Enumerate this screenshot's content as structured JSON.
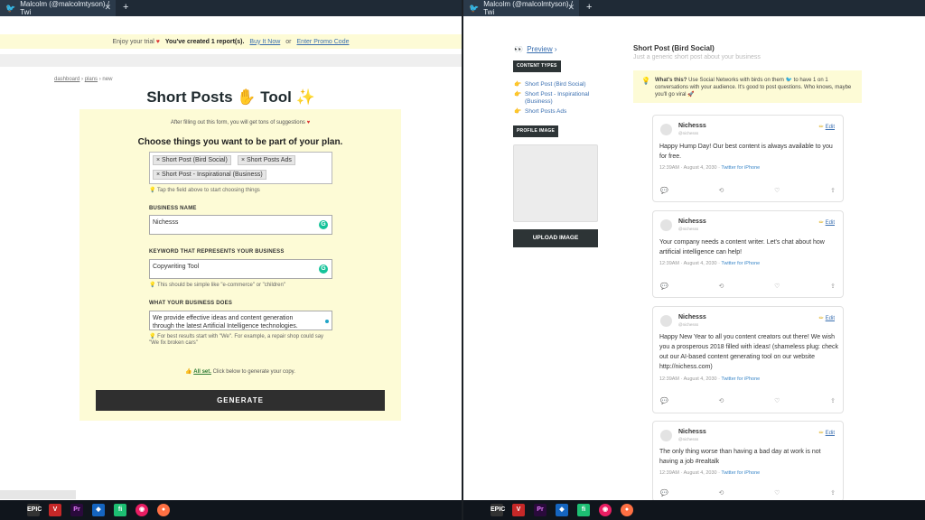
{
  "left": {
    "tab_title": "Malcolm (@malcolmtyson) / Twi",
    "trial": {
      "text": "Enjoy your trial",
      "created": "You've created 1 report(s).",
      "buy": "Buy It Now",
      "or": "or",
      "promo": "Enter Promo Code"
    },
    "breadcrumb": {
      "dashboard": "dashboard",
      "plans": "plans",
      "current": "new",
      "sep": "›"
    },
    "title": "Short Posts",
    "title_tool": "Tool",
    "intro": "After filling out this form, you will get tons of suggestions",
    "heading": "Choose things you want to be part of your plan.",
    "tags": [
      "Short Post (Bird Social)",
      "Short Posts Ads",
      "Short Post - Inspirational (Business)"
    ],
    "tag_hint": "Tap the field above to start choosing things",
    "business_name_label": "BUSINESS NAME",
    "business_name_value": "Nichesss",
    "keyword_label": "KEYWORD THAT REPRESENTS YOUR BUSINESS",
    "keyword_value": "Copywriting Tool",
    "keyword_hint": "This should be simple like \"e-commerce\" or \"children\"",
    "does_label": "WHAT YOUR BUSINESS DOES",
    "does_value_1": "We provide effective ideas and content generation",
    "does_value_2": "through the latest Artificial Intelligence technologies.",
    "does_hint_1": "For best results start with \"We\". For example, a repair shop could say",
    "does_hint_2": "\"We fix broken cars\"",
    "allset_link": "All set.",
    "allset_text": "Click below to generate your copy.",
    "generate_label": "GENERATE"
  },
  "right": {
    "tab_title": "Malcolm (@malcolmtyson) / Twi",
    "preview_label": "Preview",
    "content_types_label": "CONTENT TYPES",
    "content_types": [
      {
        "label": "Short Post (Bird Social)"
      },
      {
        "label": "Short Post - Inspirational (Business)"
      },
      {
        "label": "Short Posts Ads"
      }
    ],
    "profile_image_label": "PROFILE IMAGE",
    "upload_label": "UPLOAD IMAGE",
    "title": "Short Post (Bird Social)",
    "subtitle": "Just a generic short post about your business",
    "tip_bold": "What's this?",
    "tip_text": "Use Social Networks with birds on them",
    "tip_text_2": "to have 1 on 1 conversations with your audience. It's good to post questions. Who knows, maybe you'll go viral",
    "tweets": [
      {
        "name": "Nichesss",
        "handle": "@nichesss",
        "edit": "Edit",
        "text": "Happy Hump Day!  Our best content is always available to you for free.",
        "time": "12:39AM · August 4, 2030 ·",
        "source": "Twitter for iPhone"
      },
      {
        "name": "Nichesss",
        "handle": "@nichesss",
        "edit": "Edit",
        "text": "Your company needs a content writer. Let's chat about how artificial intelligence can help!",
        "time": "12:39AM · August 4, 2030 ·",
        "source": "Twitter for iPhone"
      },
      {
        "name": "Nichesss",
        "handle": "@nichesss",
        "edit": "Edit",
        "text": "Happy New Year to all you content creators out there! We wish you a prosperous 2018 filled with ideas! (shameless plug: check out our AI-based content generating tool on our website http://nichess.com)",
        "time": "12:39AM · August 4, 2030 ·",
        "source": "Twitter for iPhone"
      },
      {
        "name": "Nichesss",
        "handle": "@nichesss",
        "edit": "Edit",
        "text": "The only thing worse than having a bad day at work is not having a job #realtalk",
        "time": "12:39AM · August 4, 2030 ·",
        "source": "Twitter for iPhone"
      }
    ]
  },
  "taskbar": {
    "icons": [
      {
        "name": "epic-games-icon",
        "label": "EPIC"
      },
      {
        "name": "vivaldi-icon",
        "label": "V"
      },
      {
        "name": "premiere-pro-icon",
        "label": "Pr"
      },
      {
        "name": "shield-icon",
        "label": "◆"
      },
      {
        "name": "fiverr-icon",
        "label": "fi"
      },
      {
        "name": "spotify-icon",
        "label": "◉"
      },
      {
        "name": "firefox-icon",
        "label": "●"
      }
    ]
  },
  "colors": {
    "accent_yellow": "#fdfbd6",
    "dark_button": "#2f2f2f",
    "link_blue": "#3a6fb0",
    "tab_bar": "#1f2a36",
    "taskbar": "#10151c"
  }
}
